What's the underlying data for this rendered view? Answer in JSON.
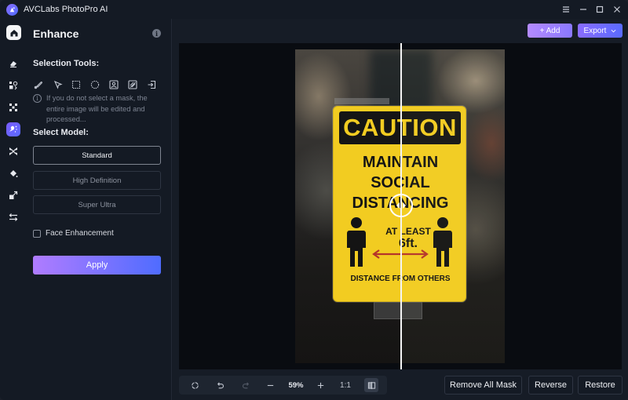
{
  "app": {
    "title": "AVCLabs PhotoPro AI",
    "window_controls": [
      "menu-icon",
      "minimize-icon",
      "maximize-icon",
      "close-icon"
    ]
  },
  "rail": {
    "items": [
      {
        "id": "home",
        "icon": "home-icon",
        "active": false
      },
      {
        "id": "object-remover",
        "icon": "eraser-icon",
        "active": false
      },
      {
        "id": "replace",
        "icon": "replace-shapes-icon",
        "active": false
      },
      {
        "id": "remove-background",
        "icon": "background-remove-icon",
        "active": false
      },
      {
        "id": "enhance",
        "icon": "enhance-sparkle-icon",
        "active": true
      },
      {
        "id": "face",
        "icon": "face-icon",
        "active": false
      },
      {
        "id": "colorize",
        "icon": "paint-bucket-icon",
        "active": false
      },
      {
        "id": "upscale",
        "icon": "upscale-icon",
        "active": false
      },
      {
        "id": "adjust",
        "icon": "adjust-sliders-icon",
        "active": false
      }
    ]
  },
  "panel": {
    "title": "Enhance",
    "info_icon": "i",
    "selection_tools_label": "Selection Tools:",
    "tools": [
      {
        "name": "brush-tool",
        "icon": "brush-icon"
      },
      {
        "name": "pointer-tool",
        "icon": "pointer-icon"
      },
      {
        "name": "rectangle-tool",
        "icon": "rectangle-select-icon"
      },
      {
        "name": "ellipse-tool",
        "icon": "ellipse-select-icon"
      },
      {
        "name": "portrait-tool",
        "icon": "portrait-select-icon"
      },
      {
        "name": "pattern-tool",
        "icon": "pattern-select-icon"
      },
      {
        "name": "import-mask-tool",
        "icon": "import-icon"
      }
    ],
    "hint_icon": "i",
    "hint": "If you do not select a mask, the entire image will be edited and processed...",
    "select_model_label": "Select Model:",
    "models": [
      {
        "label": "Standard",
        "selected": true
      },
      {
        "label": "High Definition",
        "selected": false
      },
      {
        "label": "Super Ultra",
        "selected": false
      }
    ],
    "face_enhancement": {
      "label": "Face Enhancement",
      "checked": false
    },
    "apply_label": "Apply"
  },
  "header": {
    "add_label": "+ Add",
    "export_label": "Export"
  },
  "image": {
    "sign_header": "CAUTION",
    "lines": [
      "MAINTAIN",
      "SOCIAL",
      "DISTANCING",
      "AT LEAST",
      "6ft.",
      "DISTANCE FROM OTHERS"
    ]
  },
  "zoombar": {
    "zoom_level": "59%",
    "actual_size_label": "1:1",
    "icons": [
      "reset-icon",
      "undo-icon",
      "redo-icon",
      "zoom-out-icon",
      "zoom-in-icon",
      "compare-icon"
    ]
  },
  "actions": {
    "remove_all_mask": "Remove All Mask",
    "reverse": "Reverse",
    "restore": "Restore"
  },
  "colors": {
    "accent_start": "#b07cff",
    "accent_end": "#4f6cff",
    "background": "#141a24",
    "sign_yellow": "#f2cc21"
  }
}
